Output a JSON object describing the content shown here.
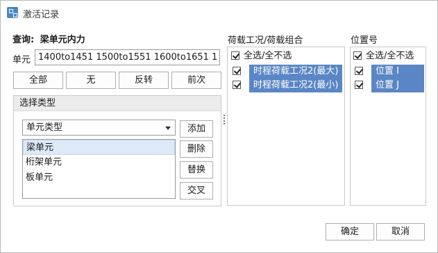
{
  "window": {
    "title": "激活记录"
  },
  "query": {
    "label": "查询:",
    "value": "梁单元内力"
  },
  "element": {
    "label": "单元",
    "value": "1400to1451 1500to1551 1600to1651 1"
  },
  "buttons": {
    "all": "全部",
    "none": "无",
    "invert": "反转",
    "previous": "前次"
  },
  "select_type": {
    "title": "选择类型",
    "dropdown_value": "单元类型",
    "items": [
      "梁单元",
      "桁架单元",
      "板单元"
    ],
    "selected_index": 0,
    "add": "添加",
    "delete": "删除",
    "replace": "替换",
    "intersect": "交叉"
  },
  "load_cases": {
    "title": "荷载工况/荷载组合",
    "select_all": "全选/全不选",
    "items": [
      "时程荷载工况2(最大)",
      "时程荷载工况2(最小)"
    ]
  },
  "positions": {
    "title": "位置号",
    "select_all": "全选/全不选",
    "items": [
      "位置 I",
      "位置 J"
    ]
  },
  "footer": {
    "ok": "确定",
    "cancel": "取消"
  },
  "colors": {
    "highlight": "#5b86c5",
    "selection": "#dce9f6",
    "icon": "#4a86c8"
  }
}
